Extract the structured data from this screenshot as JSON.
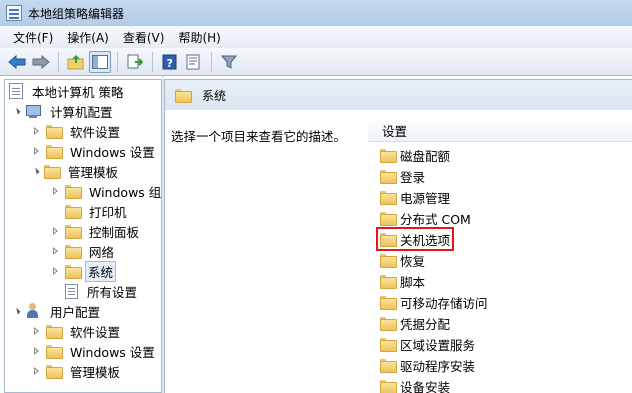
{
  "window": {
    "title": "本地组策略编辑器"
  },
  "menu": [
    "文件(F)",
    "操作(A)",
    "查看(V)",
    "帮助(H)"
  ],
  "toolbar": {
    "icons": [
      "back-arrow-icon",
      "forward-arrow-icon",
      "up-folder-icon",
      "show-hide-tree-icon",
      "export-list-icon",
      "help-icon",
      "properties-icon",
      "filter-icon"
    ]
  },
  "tree": {
    "root": "本地计算机 策略",
    "computer_config": "计算机配置",
    "software_settings": "软件设置",
    "windows_settings": "Windows 设置",
    "admin_templates": "管理模板",
    "windows_components": "Windows 组件",
    "printers": "打印机",
    "control_panel": "控制面板",
    "network": "网络",
    "system": "系统",
    "all_settings": "所有设置",
    "user_config": "用户配置",
    "user_software_settings": "软件设置",
    "user_windows_settings": "Windows 设置",
    "user_admin_templates": "管理模板"
  },
  "right_pane": {
    "header_title": "系统",
    "description": "选择一个项目来查看它的描述。",
    "list_header": "设置",
    "items": [
      "磁盘配额",
      "登录",
      "电源管理",
      "分布式 COM",
      "关机选项",
      "恢复",
      "脚本",
      "可移动存储访问",
      "凭据分配",
      "区域设置服务",
      "驱动程序安装",
      "设备安装"
    ],
    "highlighted_item": "关机选项"
  },
  "colors": {
    "highlight_border": "#e3161f",
    "selection_bg": "#e5eef9",
    "folder_yellow": "#eec35b"
  }
}
